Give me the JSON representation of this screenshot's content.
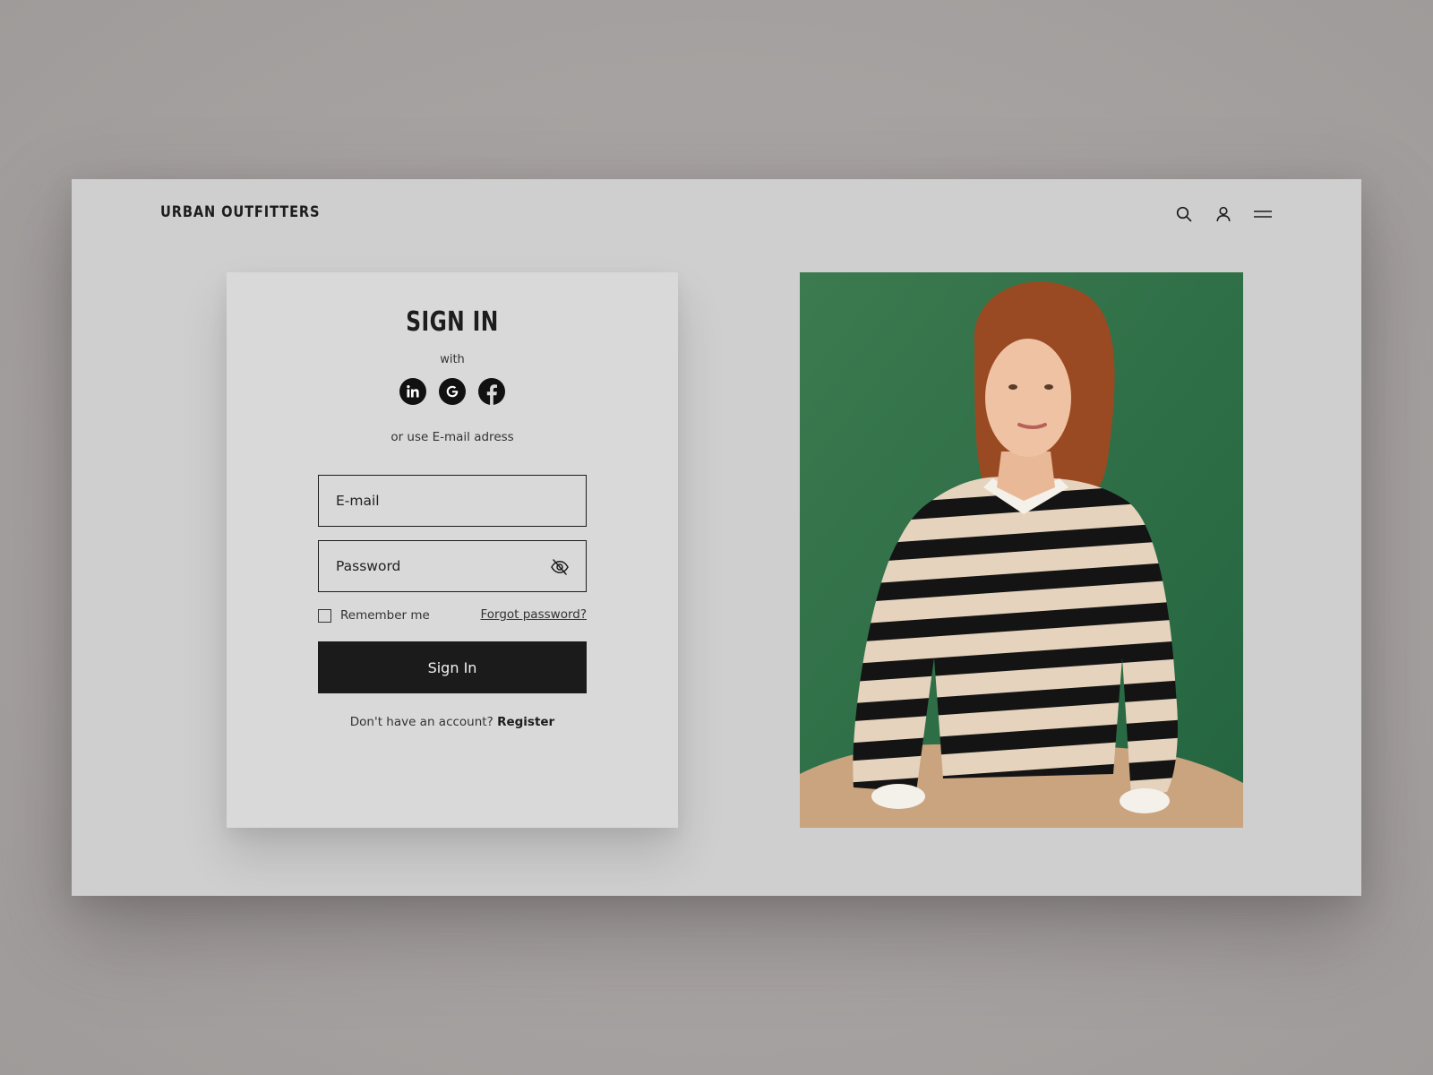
{
  "header": {
    "logo": "URBAN OUTFITTERS",
    "icons": [
      "search-icon",
      "user-icon",
      "menu-icon"
    ]
  },
  "signin": {
    "title": "SIGN IN",
    "with_label": "with",
    "social_providers": [
      "linkedin",
      "google",
      "facebook"
    ],
    "or_use_label": "or use E-mail adress",
    "email_placeholder": "E-mail",
    "password_placeholder": "Password",
    "remember_label": "Remember me",
    "forgot_label": "Forgot password?",
    "button_label": "Sign In",
    "no_account_label": "Don't have an account?",
    "register_label": "Register"
  },
  "colors": {
    "backdrop": "#a8a4a3",
    "window": "#cfcfcf",
    "card": "#d9d9d9",
    "button": "#1c1b1c",
    "photo_background": "#2f6f47"
  }
}
